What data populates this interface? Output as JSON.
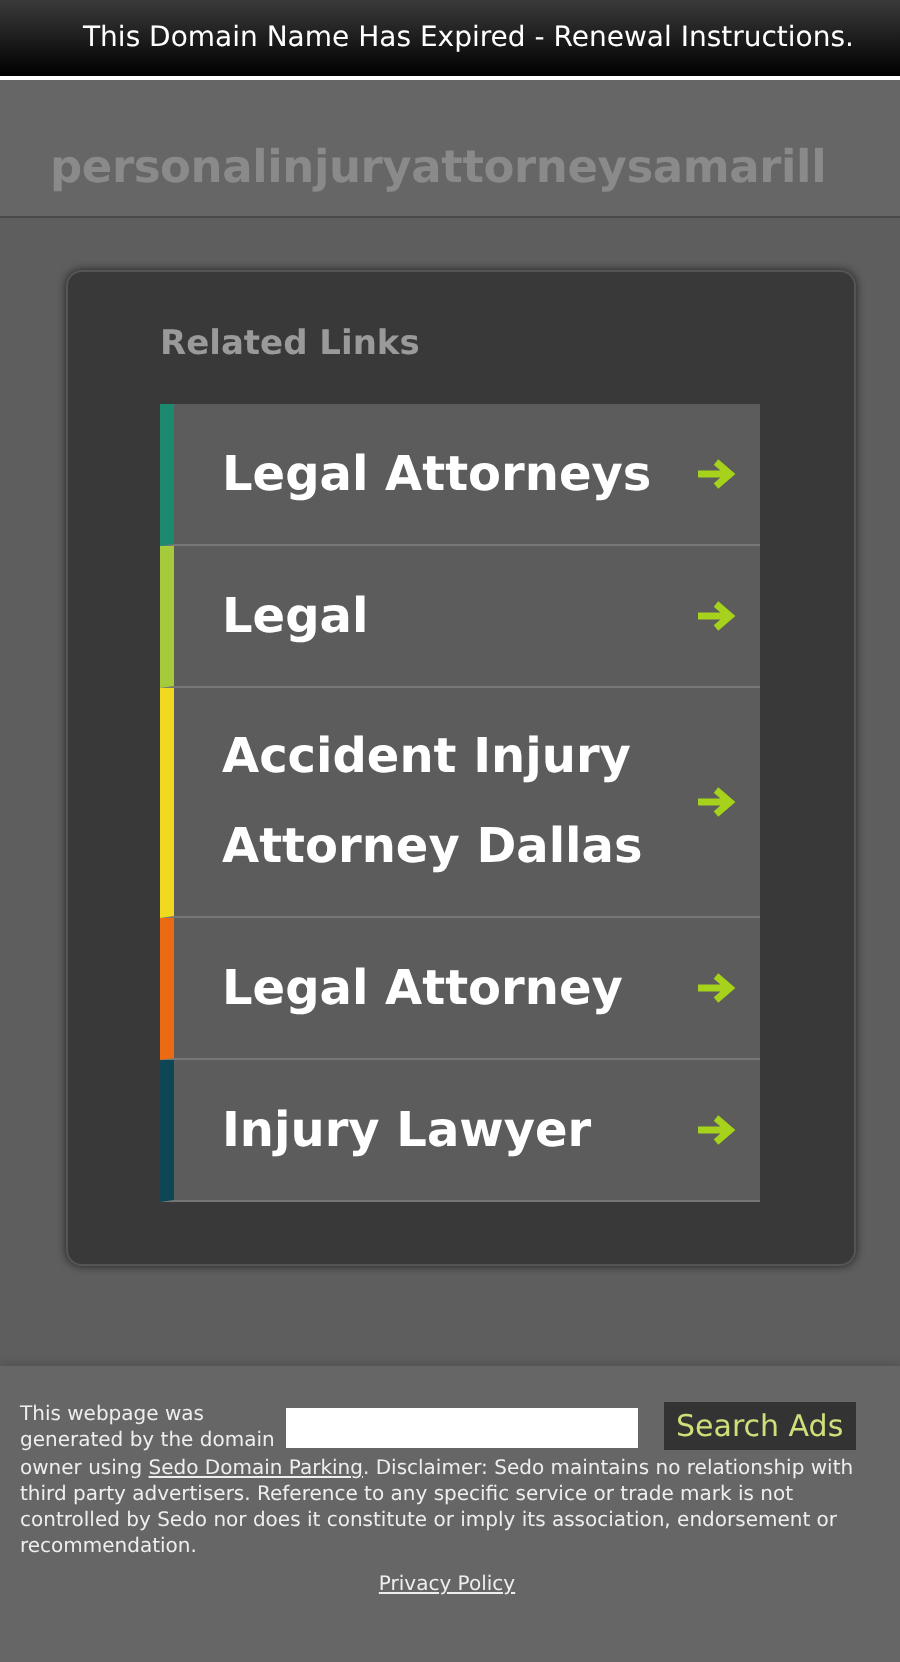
{
  "top_bar": {
    "notice": "This Domain Name Has Expired - Renewal Instructions."
  },
  "header": {
    "domain": "personalinjuryattorneysamarill"
  },
  "related_links": {
    "heading": "Related Links",
    "links": [
      {
        "label": "Legal Attorneys",
        "color": "#1b8a6f"
      },
      {
        "label": "Legal",
        "color": "#a5cb3c"
      },
      {
        "label": "Accident Injury Attorney Dallas",
        "color": "#f0d91f"
      },
      {
        "label": "Legal Attorney",
        "color": "#ec6b12"
      },
      {
        "label": "Injury Lawyer",
        "color": "#0e4655"
      }
    ]
  },
  "footer": {
    "search_button": "Search Ads",
    "intro": "This webpage was generated by the domain",
    "disclaimer": "owner using ",
    "disclaimer_link": "Sedo Domain Parking",
    "disclaimer_rest": ". Disclaimer: Sedo maintains no relationship with third party advertisers. Reference to any specific service or trade mark is not controlled by Sedo nor does it constitute or imply its association, endorsement or recommendation.",
    "privacy_link": "Privacy Policy"
  }
}
